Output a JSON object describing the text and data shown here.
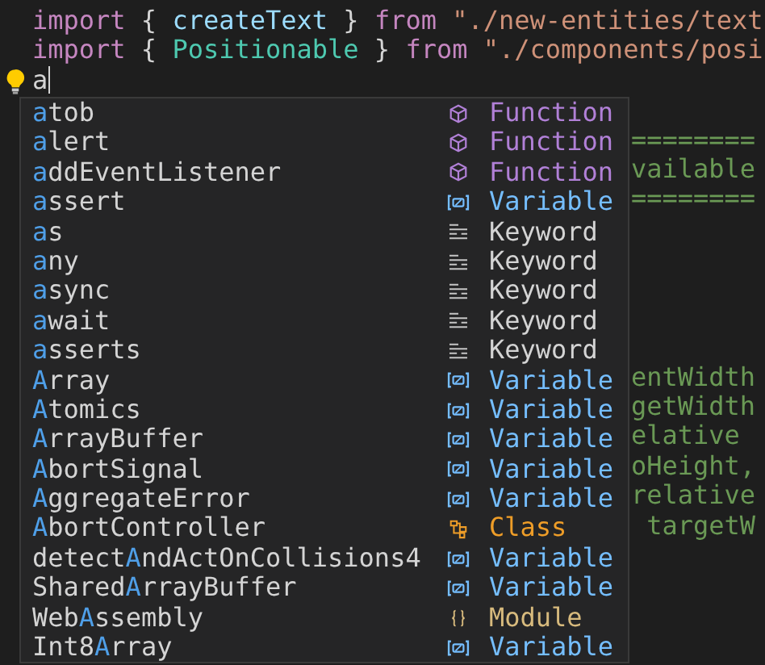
{
  "editor": {
    "lines": [
      {
        "kind": "code",
        "tokens": [
          {
            "kind": "keyword",
            "text": "import"
          },
          {
            "kind": "punct",
            "text": " { "
          },
          {
            "kind": "variable",
            "text": "createText"
          },
          {
            "kind": "punct",
            "text": " } "
          },
          {
            "kind": "keyword",
            "text": "from"
          },
          {
            "kind": "string",
            "text": " \"./new-entities/text"
          }
        ]
      },
      {
        "kind": "code",
        "tokens": [
          {
            "kind": "keyword",
            "text": "import"
          },
          {
            "kind": "punct",
            "text": " { "
          },
          {
            "kind": "type",
            "text": "Positionable"
          },
          {
            "kind": "punct",
            "text": " } "
          },
          {
            "kind": "keyword",
            "text": "from"
          },
          {
            "kind": "string",
            "text": " \"./components/posi"
          }
        ]
      },
      {
        "kind": "cursor",
        "tokens": [
          {
            "kind": "punct",
            "text": "a"
          }
        ]
      },
      {
        "kind": "blank"
      },
      {
        "kind": "tail",
        "tokens": [
          {
            "kind": "comment",
            "text": "========"
          }
        ]
      },
      {
        "kind": "tail",
        "tokens": [
          {
            "kind": "comment",
            "text": "vailable"
          }
        ]
      },
      {
        "kind": "tail",
        "tokens": [
          {
            "kind": "comment",
            "text": "========"
          }
        ]
      },
      {
        "kind": "blank"
      },
      {
        "kind": "blank"
      },
      {
        "kind": "blank"
      },
      {
        "kind": "blank"
      },
      {
        "kind": "blank"
      },
      {
        "kind": "tail",
        "tokens": [
          {
            "kind": "comment",
            "text": "entWidth"
          }
        ]
      },
      {
        "kind": "tail",
        "tokens": [
          {
            "kind": "comment",
            "text": "getWidth"
          }
        ]
      },
      {
        "kind": "tail",
        "tokens": [
          {
            "kind": "comment",
            "text": "elative"
          }
        ]
      },
      {
        "kind": "tail",
        "tokens": [
          {
            "kind": "comment",
            "text": "oHeight,"
          }
        ]
      },
      {
        "kind": "tail",
        "tokens": [
          {
            "kind": "comment",
            "text": "relative"
          }
        ]
      },
      {
        "kind": "tail",
        "tokens": [
          {
            "kind": "comment",
            "text": " targetW"
          }
        ]
      }
    ]
  },
  "suggestions": [
    {
      "match": "a",
      "suffix": "tob",
      "kind": "function",
      "type": "Function",
      "selected": false
    },
    {
      "match": "a",
      "suffix": "lert",
      "kind": "function",
      "type": "Function",
      "selected": false
    },
    {
      "match": "a",
      "suffix": "ddEventListener",
      "kind": "function",
      "type": "Function",
      "selected": false
    },
    {
      "match": "a",
      "suffix": "ssert",
      "kind": "variable",
      "type": "Variable",
      "selected": false
    },
    {
      "match": "a",
      "suffix": "s",
      "kind": "keyword",
      "type": "Keyword",
      "selected": false
    },
    {
      "match": "a",
      "suffix": "ny",
      "kind": "keyword",
      "type": "Keyword",
      "selected": false
    },
    {
      "match": "a",
      "suffix": "sync",
      "kind": "keyword",
      "type": "Keyword",
      "selected": false
    },
    {
      "match": "a",
      "suffix": "wait",
      "kind": "keyword",
      "type": "Keyword",
      "selected": false
    },
    {
      "match": "a",
      "suffix": "sserts",
      "kind": "keyword",
      "type": "Keyword",
      "selected": false
    },
    {
      "match": "A",
      "suffix": "rray",
      "kind": "variable",
      "type": "Variable",
      "selected": false
    },
    {
      "match": "A",
      "suffix": "tomics",
      "kind": "variable",
      "type": "Variable",
      "selected": false
    },
    {
      "match": "A",
      "suffix": "rrayBuffer",
      "kind": "variable",
      "type": "Variable",
      "selected": false
    },
    {
      "match": "A",
      "suffix": "bortSignal",
      "kind": "variable",
      "type": "Variable",
      "selected": false
    },
    {
      "match": "A",
      "suffix": "ggregateError",
      "kind": "variable",
      "type": "Variable",
      "selected": false
    },
    {
      "match": "A",
      "suffix": "bortController",
      "kind": "class",
      "type": "Class",
      "selected": false
    },
    {
      "prefix": "detect",
      "match": "A",
      "suffix": "ndActOnCollisions4",
      "kind": "variable",
      "type": "Variable",
      "selected": false
    },
    {
      "prefix": "Shared",
      "match": "A",
      "suffix": "rrayBuffer",
      "kind": "variable",
      "type": "Variable",
      "selected": false
    },
    {
      "prefix": "Web",
      "match": "A",
      "suffix": "ssembly",
      "kind": "module",
      "type": "Module",
      "selected": false
    },
    {
      "prefix": "Int8",
      "match": "A",
      "suffix": "rray",
      "kind": "variable",
      "type": "Variable",
      "selected": false
    }
  ]
}
